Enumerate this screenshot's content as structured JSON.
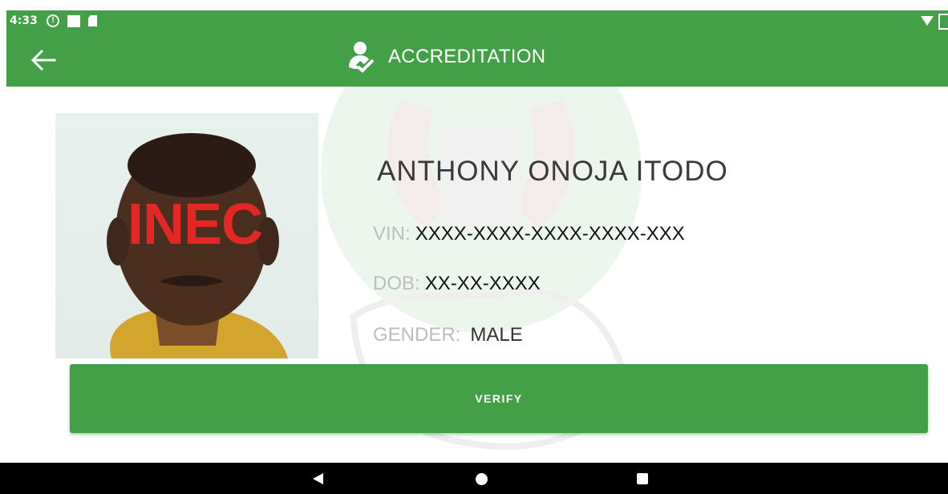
{
  "status_bar": {
    "time": "4:33",
    "icons": [
      "alert-icon",
      "notification-square-icon",
      "sim-icon",
      "wifi-icon",
      "battery-icon"
    ]
  },
  "app_bar": {
    "title": "ACCREDITATION",
    "back_icon": "arrow-left-icon",
    "title_icon": "user-check-icon",
    "color": "#43a047"
  },
  "voter": {
    "photo_stamp": "INEC",
    "name": "ANTHONY ONOJA ITODO",
    "vin_label": "VIN:",
    "vin_value": "XXXX-XXXX-XXXX-XXXX-XXX",
    "dob_label": "DOB:",
    "dob_value": "XX-XX-XXXX",
    "gender_label": "GENDER:",
    "gender_value": "MALE"
  },
  "actions": {
    "verify_label": "VERIFY"
  },
  "nav_bar": {
    "icons": [
      "nav-back-icon",
      "nav-home-icon",
      "nav-recents-icon"
    ]
  }
}
